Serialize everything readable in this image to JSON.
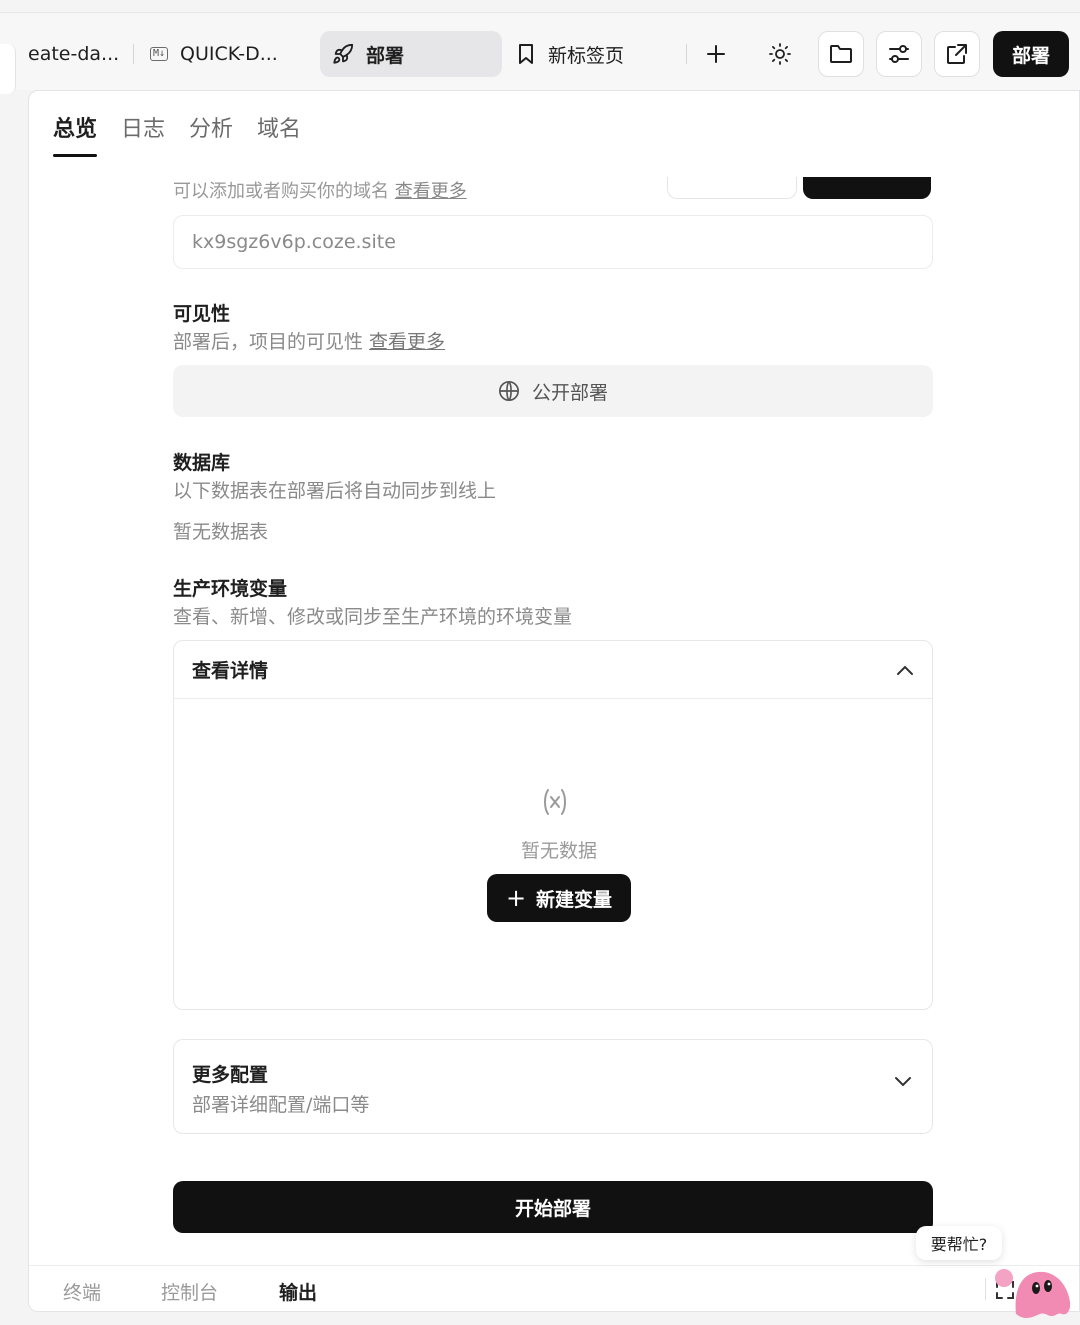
{
  "tabs": [
    {
      "label": "eate-da...",
      "icon": "none"
    },
    {
      "label": "QUICK-D...",
      "icon": "markdown-icon",
      "badge": "M↓"
    },
    {
      "label": "部署",
      "icon": "rocket-icon",
      "active": true
    },
    {
      "label": "新标签页",
      "icon": "bookmark-icon"
    }
  ],
  "toolbar": {
    "add_label": "+",
    "deploy_label": "部署"
  },
  "subtabs": [
    "总览",
    "日志",
    "分析",
    "域名"
  ],
  "domain": {
    "hint": "可以添加或者购买你的域名",
    "hint_link": "查看更多",
    "value": "kx9sgz6v6p.coze.site"
  },
  "visibility": {
    "title": "可见性",
    "desc": "部署后，项目的可见性",
    "link": "查看更多",
    "button": "公开部署"
  },
  "database": {
    "title": "数据库",
    "desc": "以下数据表在部署后将自动同步到线上",
    "empty": "暂无数据表"
  },
  "env": {
    "title": "生产环境变量",
    "desc": "查看、新增、修改或同步至生产环境的环境变量",
    "card_title": "查看详情",
    "empty": "暂无数据",
    "new_button": "新建变量"
  },
  "more": {
    "title": "更多配置",
    "desc": "部署详细配置/端口等"
  },
  "start_button": "开始部署",
  "bottom_tabs": [
    "终端",
    "控制台",
    "输出"
  ],
  "help": "要帮忙?",
  "colors": {
    "primary": "#111111",
    "muted": "#8a8a8a",
    "mascot": "#f28bb3"
  }
}
